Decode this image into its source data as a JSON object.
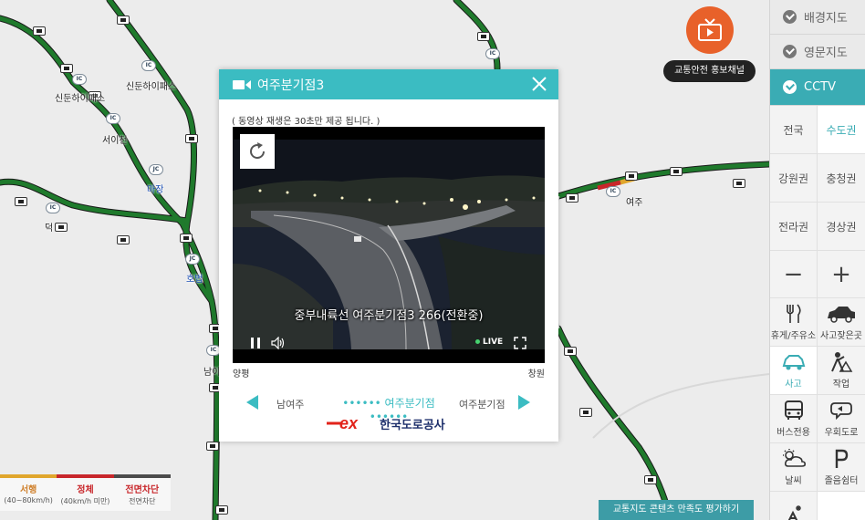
{
  "map": {
    "labels": {
      "sindun_ic": "신둔하이패스",
      "sindun_ic2": "신둔하이패스",
      "seoichon": "서이천",
      "majang": "마장",
      "deok": "덕",
      "hobeop": "호법",
      "nam": "남이",
      "yeoju": "여주",
      "ic": "IC",
      "jc": "JC"
    },
    "legend": [
      {
        "title": "서행",
        "sub": "(40~80km/h)"
      },
      {
        "title": "정체",
        "sub": "(40km/h 미만)"
      },
      {
        "title": "전면차단",
        "sub": "전면차단"
      }
    ],
    "tv_label": "교통안전 홍보채널",
    "survey": "교통지도 콘텐츠 만족도 평가하기"
  },
  "panel": {
    "layers": [
      {
        "label": "배경지도",
        "active": false
      },
      {
        "label": "영문지도",
        "active": false
      },
      {
        "label": "CCTV",
        "active": true
      }
    ],
    "regions": [
      "전국",
      "수도권",
      "강원권",
      "충청권",
      "전라권",
      "경상권"
    ],
    "active_region": "수도권",
    "zoom_out": "−",
    "zoom_in": "+",
    "tools": [
      {
        "label": "휴게/주유소",
        "icon": "fork-knife-icon"
      },
      {
        "label": "사고잦은곳",
        "icon": "car-crash-icon"
      },
      {
        "label": "사고",
        "icon": "accident-car-icon"
      },
      {
        "label": "작업",
        "icon": "worker-icon"
      },
      {
        "label": "버스전용",
        "icon": "bus-icon"
      },
      {
        "label": "우회도로",
        "icon": "detour-icon"
      },
      {
        "label": "날씨",
        "icon": "weather-icon"
      },
      {
        "label": "졸음쉼터",
        "icon": "parking-icon"
      },
      {
        "label": "",
        "icon": "snow-icon"
      }
    ]
  },
  "modal": {
    "title": "여주분기점3",
    "notice": "( 동영상 재생은 30초만 제공 됩니다. )",
    "caption": "중부내륙선 여주분기점3 266(전환중)",
    "live": "LIVE",
    "direction_left": "양평",
    "direction_right": "창원",
    "prev_label": "남여주",
    "current_label": "•••••• 여주분기점 ••••••",
    "next_label": "여주분기점",
    "logo_text": "한국도로공사",
    "logo_mark": "ex"
  },
  "colors": {
    "accent": "#3bbcc2",
    "road_green": "#1f7a2c",
    "jam_red": "#c8262a",
    "slow_yellow": "#e0a62c",
    "tv_orange": "#e8612a",
    "logo_red": "#e2231a",
    "logo_navy": "#1d2f6b"
  }
}
